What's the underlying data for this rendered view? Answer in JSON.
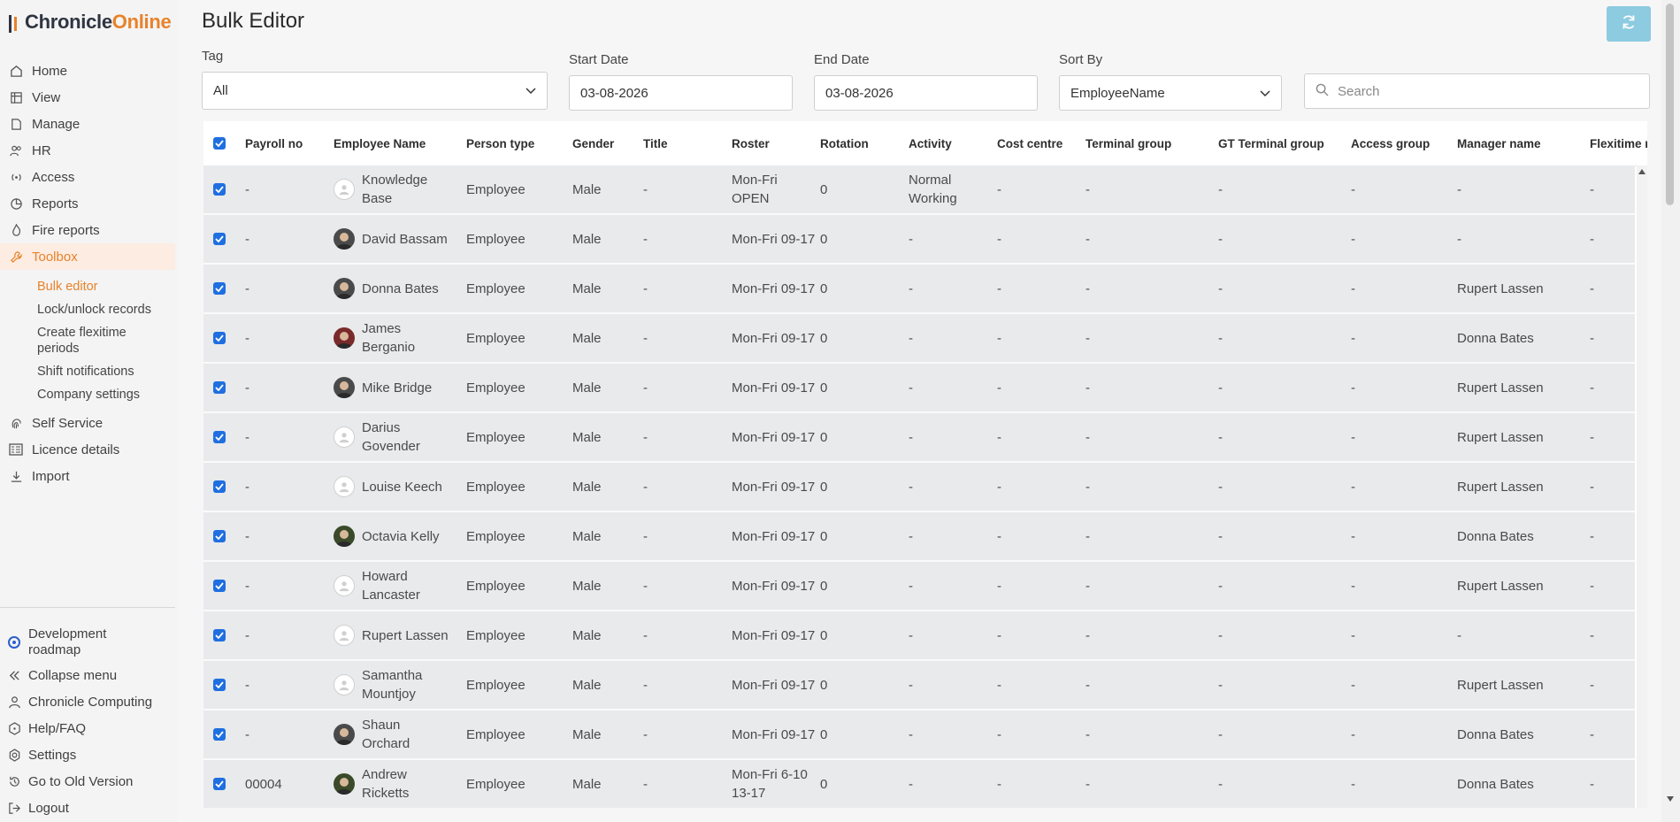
{
  "brand": {
    "name_part1": "Chronicle",
    "name_part2": "Online",
    "accent": "#e8822a"
  },
  "sidebar": {
    "items": [
      {
        "label": "Home",
        "icon": "home-icon"
      },
      {
        "label": "View",
        "icon": "grid-icon"
      },
      {
        "label": "Manage",
        "icon": "file-icon"
      },
      {
        "label": "HR",
        "icon": "people-icon"
      },
      {
        "label": "Access",
        "icon": "signal-icon"
      },
      {
        "label": "Reports",
        "icon": "chart-icon"
      },
      {
        "label": "Fire reports",
        "icon": "fire-icon"
      },
      {
        "label": "Toolbox",
        "icon": "wrench-icon",
        "active": true
      }
    ],
    "toolbox_sub": [
      {
        "label": "Bulk editor",
        "active": true
      },
      {
        "label": "Lock/unlock records"
      },
      {
        "label": "Create flexitime periods"
      },
      {
        "label": "Shift notifications"
      },
      {
        "label": "Company settings"
      }
    ],
    "items2": [
      {
        "label": "Self Service",
        "icon": "fingerprint-icon"
      },
      {
        "label": "Licence details",
        "icon": "id-card-icon"
      },
      {
        "label": "Import",
        "icon": "download-icon"
      }
    ],
    "bottom": [
      {
        "label": "Development roadmap",
        "icon": "roadmap-icon"
      },
      {
        "label": "Collapse menu",
        "icon": "double-chevron-left-icon"
      },
      {
        "label": "Chronicle Computing",
        "icon": "user-icon"
      },
      {
        "label": "Help/FAQ",
        "icon": "help-icon"
      },
      {
        "label": "Settings",
        "icon": "gear-icon"
      },
      {
        "label": "Go to Old Version",
        "icon": "history-icon"
      },
      {
        "label": "Logout",
        "icon": "logout-icon"
      }
    ]
  },
  "page": {
    "title": "Bulk Editor"
  },
  "filters": {
    "tag_label": "Tag",
    "tag_value": "All",
    "start_label": "Start Date",
    "start_value": "03-08-2026",
    "end_label": "End Date",
    "end_value": "03-08-2026",
    "sort_label": "Sort By",
    "sort_value": "EmployeeName",
    "search_placeholder": "Search"
  },
  "table": {
    "columns": [
      "Payroll no",
      "Employee Name",
      "Person type",
      "Gender",
      "Title",
      "Roster",
      "Rotation",
      "Activity",
      "Cost centre",
      "Terminal group",
      "GT Terminal group",
      "Access group",
      "Manager name",
      "Flexitime r"
    ],
    "rows": [
      [
        "-",
        "Knowledge Base",
        "Employee",
        "Male",
        "-",
        "Mon-Fri OPEN",
        "0",
        "Normal Working",
        "-",
        "-",
        "-",
        "-",
        "-",
        "-"
      ],
      [
        "-",
        "David Bassam",
        "Employee",
        "Male",
        "-",
        "Mon-Fri 09-17",
        "0",
        "-",
        "-",
        "-",
        "-",
        "-",
        "-",
        "-"
      ],
      [
        "-",
        "Donna Bates",
        "Employee",
        "Male",
        "-",
        "Mon-Fri 09-17",
        "0",
        "-",
        "-",
        "-",
        "-",
        "-",
        "Rupert Lassen",
        "-"
      ],
      [
        "-",
        "James Berganio",
        "Employee",
        "Male",
        "-",
        "Mon-Fri 09-17",
        "0",
        "-",
        "-",
        "-",
        "-",
        "-",
        "Donna Bates",
        "-"
      ],
      [
        "-",
        "Mike Bridge",
        "Employee",
        "Male",
        "-",
        "Mon-Fri 09-17",
        "0",
        "-",
        "-",
        "-",
        "-",
        "-",
        "Rupert Lassen",
        "-"
      ],
      [
        "-",
        "Darius Govender",
        "Employee",
        "Male",
        "-",
        "Mon-Fri 09-17",
        "0",
        "-",
        "-",
        "-",
        "-",
        "-",
        "Rupert Lassen",
        "-"
      ],
      [
        "-",
        "Louise Keech",
        "Employee",
        "Male",
        "-",
        "Mon-Fri 09-17",
        "0",
        "-",
        "-",
        "-",
        "-",
        "-",
        "Rupert Lassen",
        "-"
      ],
      [
        "-",
        "Octavia Kelly",
        "Employee",
        "Male",
        "-",
        "Mon-Fri 09-17",
        "0",
        "-",
        "-",
        "-",
        "-",
        "-",
        "Donna Bates",
        "-"
      ],
      [
        "-",
        "Howard Lancaster",
        "Employee",
        "Male",
        "-",
        "Mon-Fri 09-17",
        "0",
        "-",
        "-",
        "-",
        "-",
        "-",
        "Rupert Lassen",
        "-"
      ],
      [
        "-",
        "Rupert Lassen",
        "Employee",
        "Male",
        "-",
        "Mon-Fri 09-17",
        "0",
        "-",
        "-",
        "-",
        "-",
        "-",
        "-",
        "-"
      ],
      [
        "-",
        "Samantha Mountjoy",
        "Employee",
        "Male",
        "-",
        "Mon-Fri 09-17",
        "0",
        "-",
        "-",
        "-",
        "-",
        "-",
        "Rupert Lassen",
        "-"
      ],
      [
        "-",
        "Shaun Orchard",
        "Employee",
        "Male",
        "-",
        "Mon-Fri 09-17",
        "0",
        "-",
        "-",
        "-",
        "-",
        "-",
        "Donna Bates",
        "-"
      ],
      [
        "00004",
        "Andrew Ricketts",
        "Employee",
        "Male",
        "-",
        "Mon-Fri 6-10 13-17",
        "0",
        "-",
        "-",
        "-",
        "-",
        "-",
        "Donna Bates",
        "-"
      ]
    ],
    "avatars": [
      "blank",
      "photo",
      "photo",
      "photo3",
      "photo",
      "blank",
      "blank",
      "photo2",
      "blank",
      "blank",
      "blank",
      "photo",
      "photo2"
    ]
  }
}
